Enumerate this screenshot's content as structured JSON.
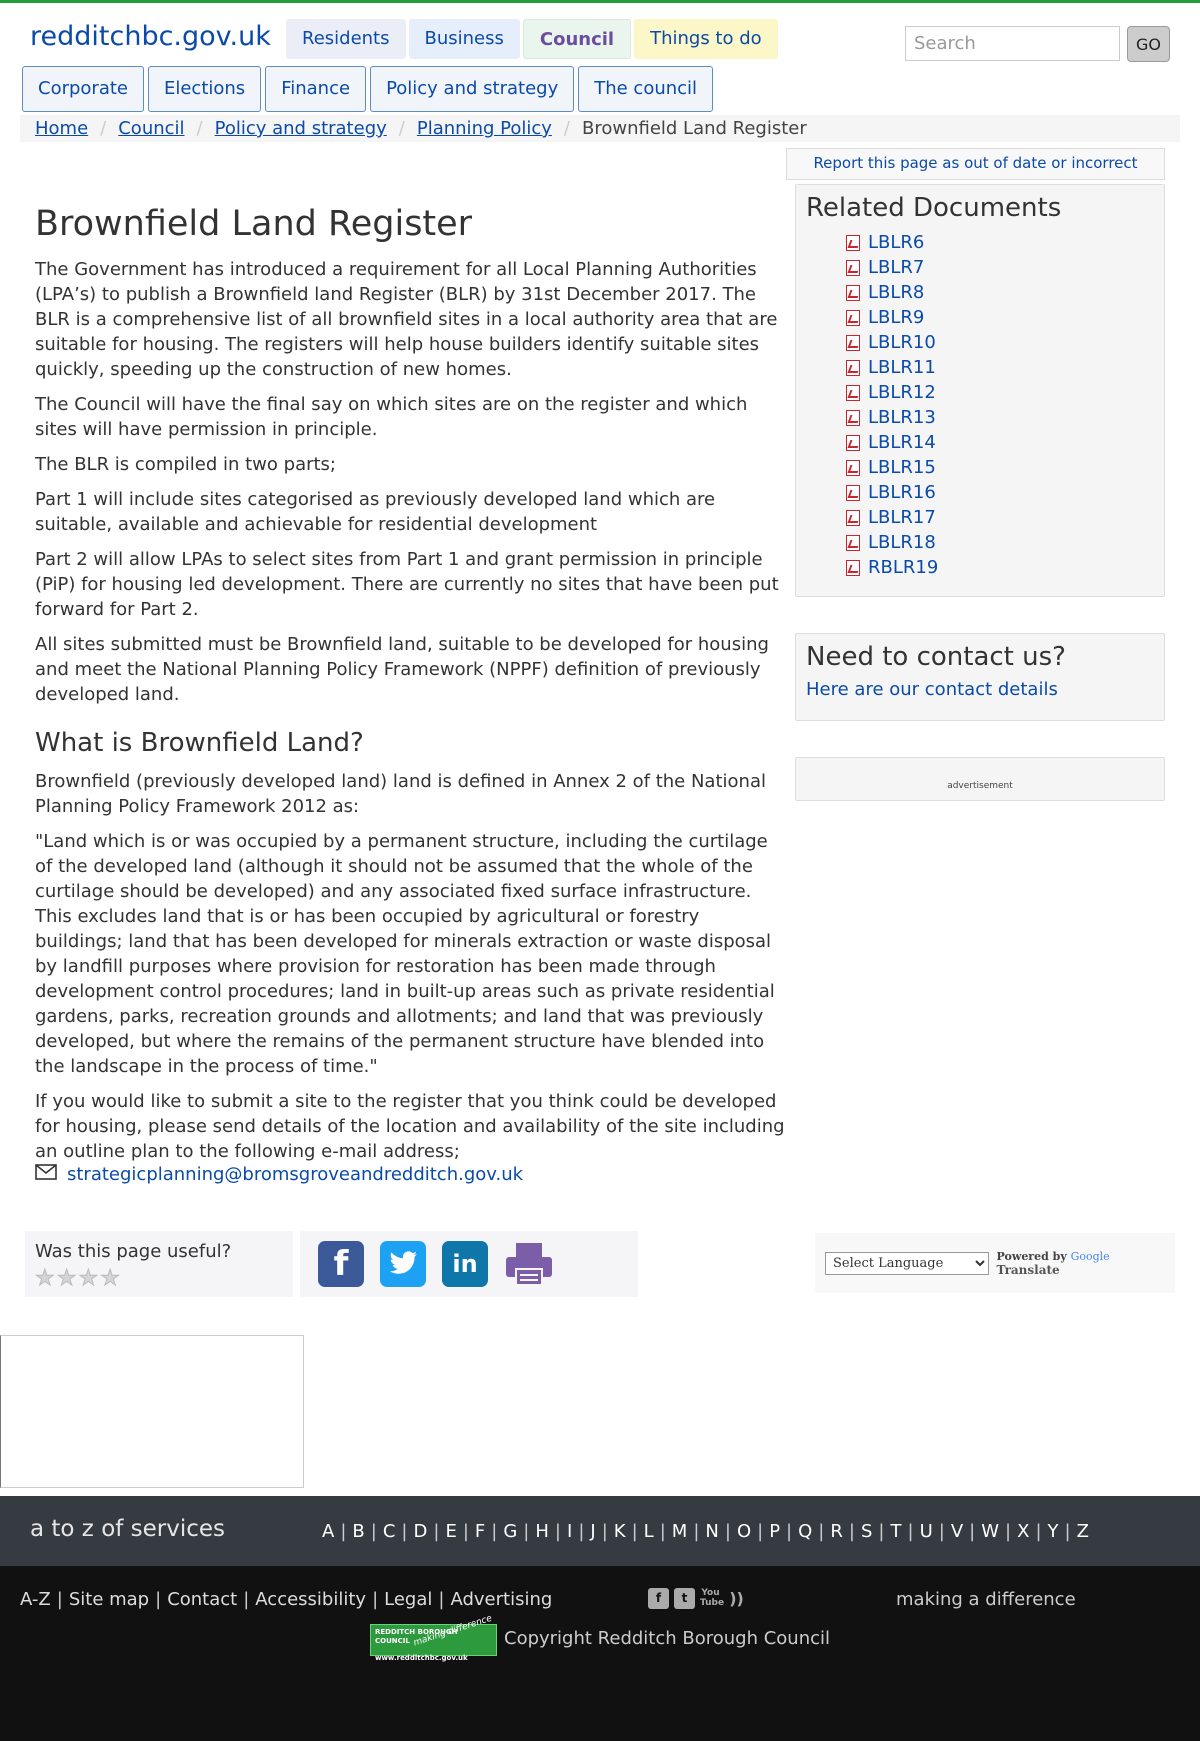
{
  "site": {
    "name": "redditchbc.gov.uk"
  },
  "top_tabs": [
    "Residents",
    "Business",
    "Council",
    "Things to do"
  ],
  "search": {
    "placeholder": "Search",
    "button": "GO"
  },
  "sub_nav": [
    "Corporate",
    "Elections",
    "Finance",
    "Policy and strategy",
    "The council"
  ],
  "breadcrumb": [
    "Home",
    "Council",
    "Policy and strategy",
    "Planning Policy"
  ],
  "breadcrumb_current": "Brownfield Land Register",
  "report_link": "Report this page as out of date or incorrect",
  "main": {
    "title": "Brownfield Land Register",
    "paragraphs": [
      "The Government has introduced a requirement for all Local Planning Authorities (LPA’s) to publish a Brownfield land Register (BLR) by 31st December 2017. The BLR is a comprehensive list of all brownfield sites in a local authority area that are suitable for housing. The registers will help house builders identify suitable sites quickly, speeding up the construction of new homes.",
      "The Council will have the final say on which sites are on the register and which sites will have permission in principle.",
      "The BLR is compiled in two parts;",
      "Part 1 will include sites categorised as previously developed land which are suitable, available and achievable for residential development",
      "Part 2 will allow LPAs to select sites from Part 1 and grant permission in principle (PiP) for housing led development. There are currently no sites that have been put forward for Part 2.",
      "All sites submitted must be Brownfield land, suitable to be developed for housing and meet the National Planning Policy Framework (NPPF) definition of previously developed land."
    ],
    "subheading": "What is Brownfield Land?",
    "paragraphs2": [
      "Brownfield (previously developed land) land is defined in Annex 2 of the National Planning Policy Framework 2012 as:",
      "\"Land which is or was occupied by a permanent structure, including the curtilage of the developed land (although it should not be assumed that the whole of the curtilage should be developed) and any associated fixed surface infrastructure. This excludes land that is or has been occupied by agricultural or forestry buildings; land that has been developed for minerals extraction or waste disposal by landfill purposes where provision for restoration has been made through development control procedures; land in built-up areas such as private residential gardens, parks, recreation grounds and allotments; and land that was previously developed, but where the remains of the permanent structure have blended into the landscape in the process of time.\"",
      "If you would like to submit a site to the register that you think could be developed for housing, please send details of the location and availability of the site including an outline plan to the following e-mail address;"
    ],
    "email": "strategicplanning@bromsgroveandredditch.gov.uk"
  },
  "related": {
    "title": "Related Documents",
    "docs": [
      "LBLR6",
      "LBLR7",
      "LBLR8",
      "LBLR9",
      "LBLR10",
      "LBLR11",
      "LBLR12",
      "LBLR13",
      "LBLR14",
      "LBLR15",
      "LBLR16",
      "LBLR17",
      "LBLR18",
      "RBLR19"
    ]
  },
  "contact": {
    "title": "Need to contact us?",
    "link": "Here are our contact details"
  },
  "ad_label": "advertisement",
  "feedback": {
    "question": "Was this page useful?",
    "stars": 4
  },
  "social_icons": [
    "facebook-icon",
    "twitter-icon",
    "linkedin-icon",
    "print-icon"
  ],
  "translate": {
    "select": "Select Language",
    "powered_by": "Powered by",
    "google": "Google",
    "translate": "Translate"
  },
  "az": {
    "title": "a to z of services",
    "letters": [
      "A",
      "B",
      "C",
      "D",
      "E",
      "F",
      "G",
      "H",
      "I",
      "J",
      "K",
      "L",
      "M",
      "N",
      "O",
      "P",
      "Q",
      "R",
      "S",
      "T",
      "U",
      "V",
      "W",
      "X",
      "Y",
      "Z"
    ]
  },
  "footer": {
    "links": [
      "A-Z",
      "Site map",
      "Contact",
      "Accessibility",
      "Legal",
      "Advertising"
    ],
    "tagline": "making a difference",
    "logo_text": "REDDITCH BOROUGH COUNCIL",
    "logo_url": "www.redditchbc.gov.uk",
    "logo_side": "making difference",
    "copyright": "Copyright Redditch Borough Council"
  },
  "colors": {
    "accent_green": "#1e9e3c",
    "link_blue": "#0b4aa8",
    "footer_dark": "#111111",
    "az_band": "#363b42"
  }
}
